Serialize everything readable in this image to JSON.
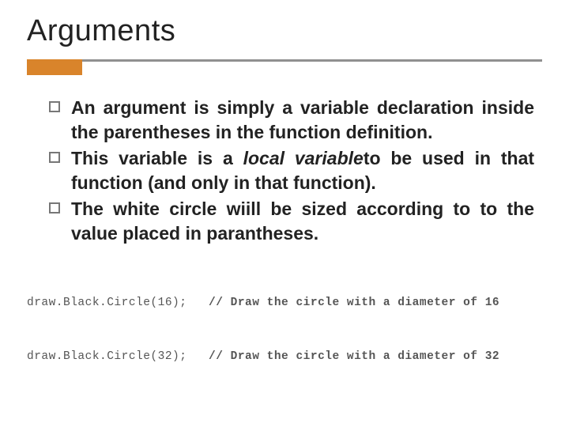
{
  "title": "Arguments",
  "bullets": [
    {
      "parts": {
        "a": "An argument is simply a variable declaration inside the parentheses in the function definition."
      }
    },
    {
      "parts": {
        "a": "This variable is a ",
        "b": "local variable",
        "c": "to be used in that function (and only in that function)."
      }
    },
    {
      "parts": {
        "a": "The white circle wiill be sized according to to the value placed in parantheses."
      }
    }
  ],
  "code": [
    {
      "call": "draw.Black.Circle(16);",
      "comment": "// Draw the circle with a diameter of 16"
    },
    {
      "call": "draw.Black.Circle(32);",
      "comment": "// Draw the circle with a diameter of 32"
    }
  ]
}
